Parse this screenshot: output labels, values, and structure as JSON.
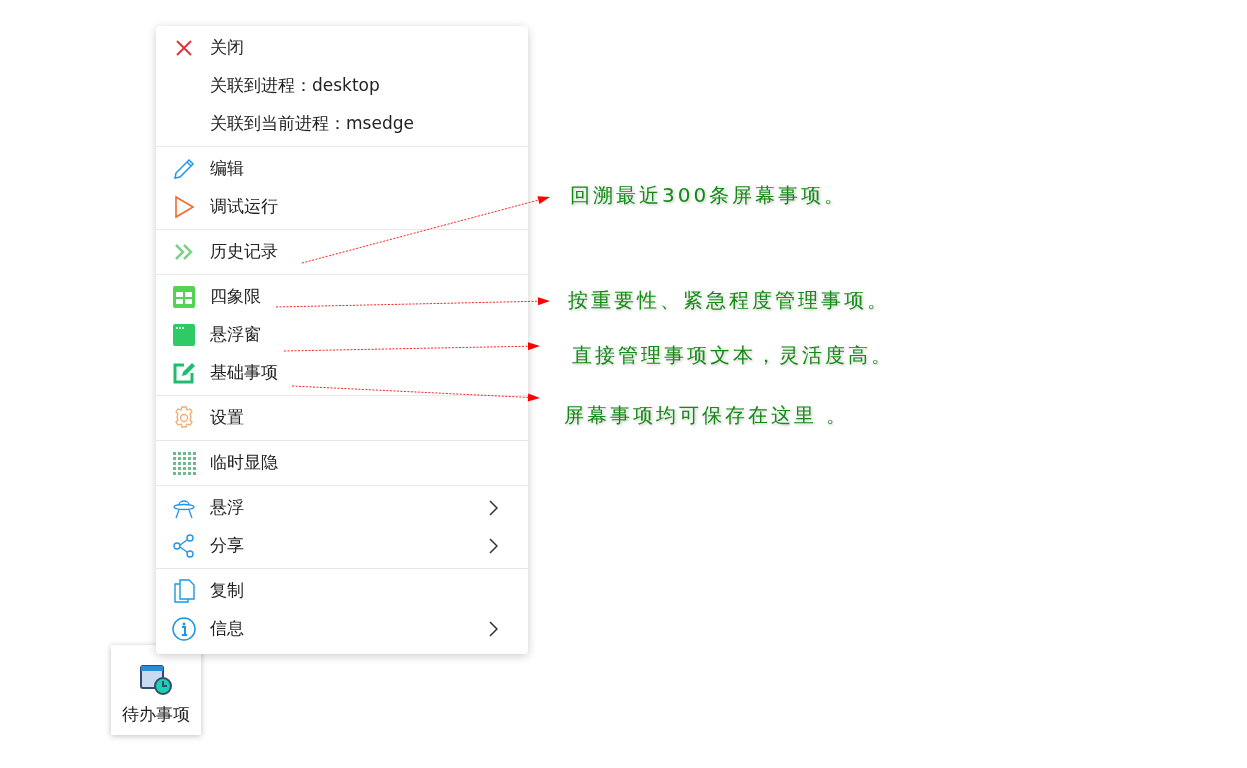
{
  "menu": {
    "groups": [
      {
        "items": [
          {
            "label": "关闭",
            "submenu": false
          },
          {
            "label": "关联到进程：desktop",
            "submenu": false
          },
          {
            "label": "关联到当前进程：msedge",
            "submenu": false
          }
        ]
      },
      {
        "items": [
          {
            "label": "编辑",
            "submenu": false
          },
          {
            "label": "调试运行",
            "submenu": false
          }
        ]
      },
      {
        "items": [
          {
            "label": "历史记录",
            "submenu": false
          }
        ]
      },
      {
        "items": [
          {
            "label": "四象限",
            "submenu": false
          },
          {
            "label": "悬浮窗",
            "submenu": false
          },
          {
            "label": "基础事项",
            "submenu": false
          }
        ]
      },
      {
        "items": [
          {
            "label": "设置",
            "submenu": false
          }
        ]
      },
      {
        "items": [
          {
            "label": "临时显隐",
            "submenu": false
          }
        ]
      },
      {
        "items": [
          {
            "label": "悬浮",
            "submenu": true
          },
          {
            "label": "分享",
            "submenu": true
          }
        ]
      },
      {
        "items": [
          {
            "label": "复制",
            "submenu": false
          },
          {
            "label": "信息",
            "submenu": true
          }
        ]
      }
    ]
  },
  "desktop_icon": {
    "label": "待办事项"
  },
  "annotations": [
    {
      "text": "回溯最近300条屏幕事项。"
    },
    {
      "text": "按重要性、紧急程度管理事项。"
    },
    {
      "text": "直接管理事项文本，灵活度高。"
    },
    {
      "text": "屏幕事项均可保存在这里 。"
    }
  ]
}
